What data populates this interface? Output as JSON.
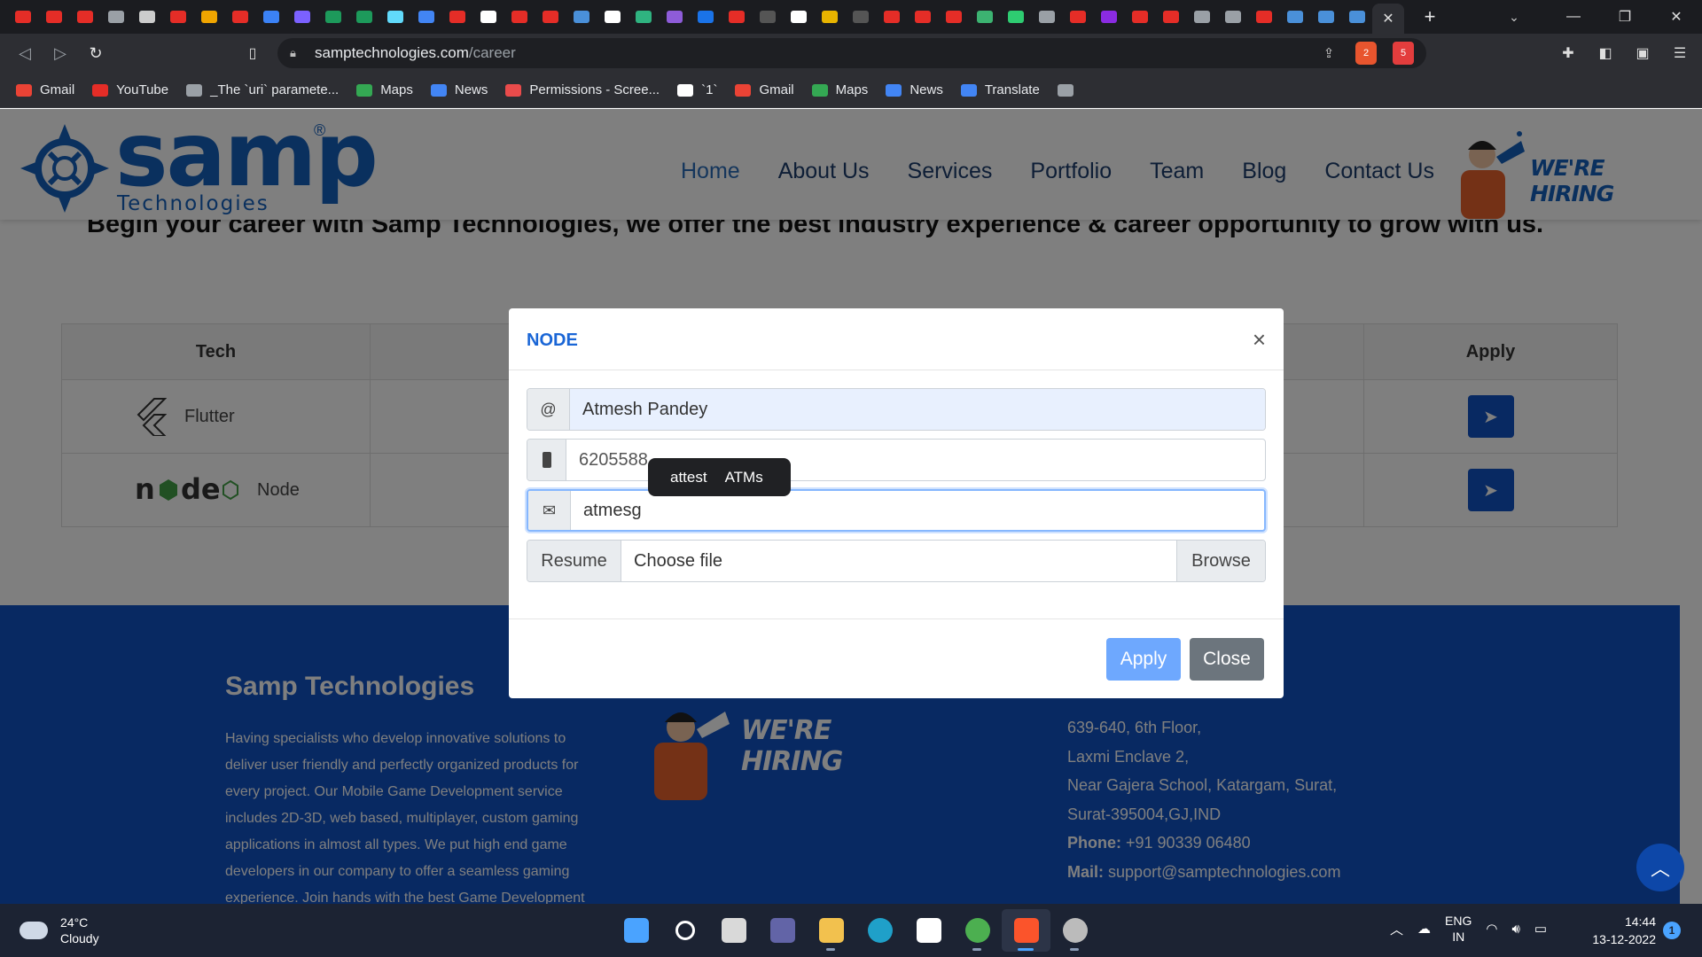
{
  "browser": {
    "tab_icon_colors": [
      "#e52d27",
      "#e52d27",
      "#e52d27",
      "#9aa0a6",
      "#cccccc",
      "#e52d27",
      "#f0a500",
      "#e52d27",
      "#3b82f6",
      "#7b61ff",
      "#1d9a5b",
      "#1d9a5b",
      "#61dafb",
      "#4285f4",
      "#e52d27",
      "#ffffff",
      "#e52d27",
      "#e52d27",
      "#4a90d9",
      "#ffffff",
      "#2fb380",
      "#8e5cd9",
      "#1a73e8",
      "#e52d27",
      "#555555",
      "#ffffff",
      "#e8b400",
      "#555555",
      "#e52d27",
      "#e52d27",
      "#e52d27",
      "#3cb371",
      "#2ecc71",
      "#9aa0a6",
      "#e52d27",
      "#8a2be2",
      "#e52d27",
      "#e52d27",
      "#9aa0a6",
      "#9aa0a6",
      "#e52d27",
      "#4a90d9",
      "#4a90d9",
      "#4a90d9"
    ],
    "active_tab_close": "✕",
    "new_tab": "+",
    "url_host": "samptechnologies.com",
    "url_path": "/career",
    "shield_badge": "2",
    "rewards_badge": "5",
    "bookmarks": [
      {
        "label": "Gmail",
        "color": "#ea4335"
      },
      {
        "label": "YouTube",
        "color": "#e52d27"
      },
      {
        "label": "_The `uri` paramete...",
        "color": "#9aa0a6"
      },
      {
        "label": "Maps",
        "color": "#34a853"
      },
      {
        "label": "News",
        "color": "#4285f4"
      },
      {
        "label": "Permissions - Scree...",
        "color": "#e94b4b"
      },
      {
        "label": "`1`",
        "color": "#ffffff"
      },
      {
        "label": "Gmail",
        "color": "#ea4335"
      },
      {
        "label": "Maps",
        "color": "#34a853"
      },
      {
        "label": "News",
        "color": "#4285f4"
      },
      {
        "label": "Translate",
        "color": "#4285f4"
      },
      {
        "label": "",
        "color": "#9aa0a6"
      }
    ]
  },
  "site": {
    "logo_text": "samp",
    "logo_sub": "Technologies",
    "logo_reg": "®",
    "nav": [
      "Home",
      "About Us",
      "Services",
      "Portfolio",
      "Team",
      "Blog",
      "Contact Us"
    ],
    "hiring": "WE'RE HIRING",
    "intro": "Begin your career with Samp Technologies, we offer the best industry experience & career opportunity to grow with us.",
    "table": {
      "headers": [
        "Tech",
        "Apply"
      ],
      "rows": [
        {
          "tech": "Flutter"
        },
        {
          "tech": "Node",
          "logo": "node"
        }
      ]
    },
    "footer": {
      "title": "Samp Technologies",
      "desc": "Having specialists who develop innovative solutions to deliver user friendly and perfectly organized products for every project. Our Mobile Game Development service includes 2D-3D, web based, multiplayer, custom gaming applications in almost all types. We put high end game developers in our company to offer a seamless gaming experience. Join hands with the best Game Development",
      "hiring": "WE'RE HIRING",
      "address_lines": [
        "639-640, 6th Floor,",
        "Laxmi Enclave 2,",
        "Near Gajera School, Katargam, Surat,",
        "Surat-395004,GJ,IND"
      ],
      "phone_label": "Phone:",
      "phone": "+91 90339 06480",
      "mail_label": "Mail:",
      "mail": "support@samptechnologies.com"
    }
  },
  "modal": {
    "title": "NODE",
    "close_x": "×",
    "name_icon": "@",
    "name_value": "Atmesh Pandey",
    "phone_value": "6205588",
    "email_value": "atmesg",
    "resume_label": "Resume",
    "file_placeholder": "Choose file",
    "browse_label": "Browse",
    "apply_label": "Apply",
    "close_label": "Close",
    "suggestions": [
      "attest",
      "ATMs"
    ]
  },
  "taskbar": {
    "temp": "24°C",
    "condition": "Cloudy",
    "apps": [
      {
        "name": "start",
        "color": "#4aa3ff"
      },
      {
        "name": "search",
        "color": "#ffffff"
      },
      {
        "name": "task-view",
        "color": "#d9d9d9"
      },
      {
        "name": "teams",
        "color": "#6264a7"
      },
      {
        "name": "file-explorer",
        "color": "#f2c14e"
      },
      {
        "name": "edge",
        "color": "#1fa0c9"
      },
      {
        "name": "store",
        "color": "#ffffff"
      },
      {
        "name": "chrome",
        "color": "#4caf50"
      },
      {
        "name": "brave",
        "color": "#fb542b"
      },
      {
        "name": "settings",
        "color": "#bbbbbb"
      }
    ],
    "lang1": "ENG",
    "lang2": "IN",
    "time": "14:44",
    "date": "13-12-2022",
    "notif_count": "1"
  }
}
